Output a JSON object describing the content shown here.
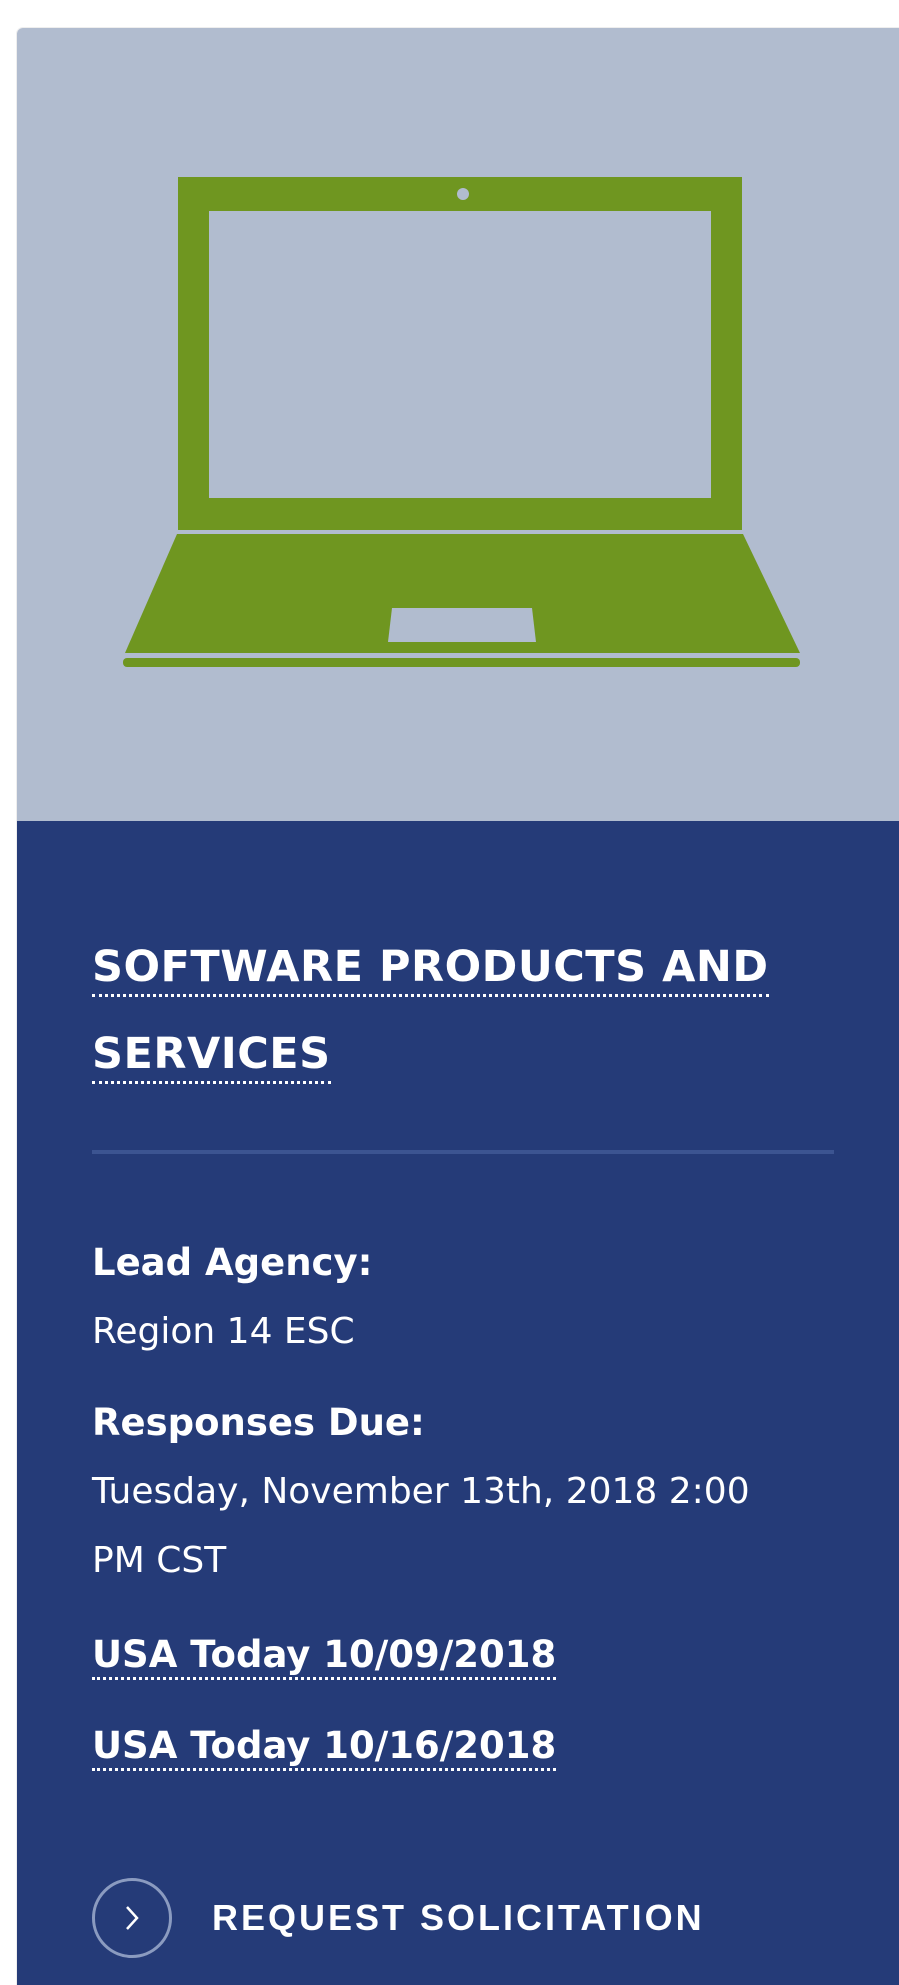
{
  "card": {
    "image_icon": "laptop-icon",
    "title": "SOFTWARE PRODUCTS AND SERVICES",
    "lead_agency_label": "Lead Agency:",
    "lead_agency_value": "Region 14 ESC",
    "responses_due_label": "Responses Due:",
    "responses_due_value": "Tuesday, November 13th, 2018 2:00 PM CST",
    "links": [
      {
        "label": "USA Today 10/09/2018"
      },
      {
        "label": "USA Today 10/16/2018"
      }
    ],
    "cta_label": "REQUEST SOLICITATION",
    "cta_icon": "chevron-right-icon"
  },
  "colors": {
    "hero_background": "#b1bccf",
    "laptop_green": "#6f9620",
    "panel_background": "#253b78",
    "divider": "#3c5491",
    "text": "#ffffff"
  }
}
